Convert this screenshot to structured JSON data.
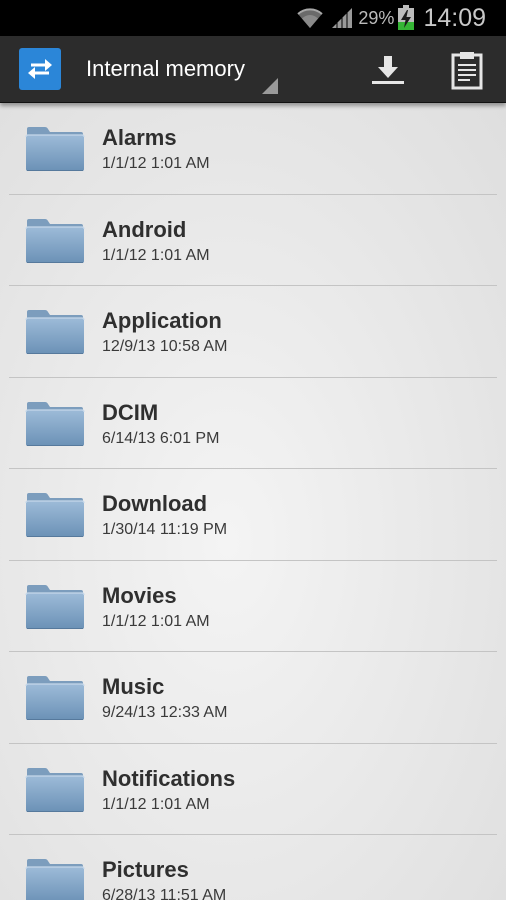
{
  "status_bar": {
    "battery_percent": "29%",
    "time": "14:09",
    "icons": [
      "wifi-icon",
      "signal-icon",
      "battery-charging-icon"
    ]
  },
  "action_bar": {
    "app_icon": "swap-arrows-icon",
    "location": "Internal memory",
    "actions": [
      {
        "icon": "download-icon"
      },
      {
        "icon": "clipboard-icon"
      }
    ]
  },
  "colors": {
    "accent": "#2b86d8",
    "folder": "#7ea3c6",
    "action_bar": "#2c2c2c"
  },
  "files": [
    {
      "name": "Alarms",
      "date": "1/1/12 1:01 AM",
      "icon": "folder-icon"
    },
    {
      "name": "Android",
      "date": "1/1/12 1:01 AM",
      "icon": "folder-icon"
    },
    {
      "name": "Application",
      "date": "12/9/13 10:58 AM",
      "icon": "folder-icon"
    },
    {
      "name": "DCIM",
      "date": "6/14/13 6:01 PM",
      "icon": "folder-icon"
    },
    {
      "name": "Download",
      "date": "1/30/14 11:19 PM",
      "icon": "folder-icon"
    },
    {
      "name": "Movies",
      "date": "1/1/12 1:01 AM",
      "icon": "folder-icon"
    },
    {
      "name": "Music",
      "date": "9/24/13 12:33 AM",
      "icon": "folder-icon"
    },
    {
      "name": "Notifications",
      "date": "1/1/12 1:01 AM",
      "icon": "folder-icon"
    },
    {
      "name": "Pictures",
      "date": "6/28/13 11:51 AM",
      "icon": "folder-icon"
    }
  ]
}
